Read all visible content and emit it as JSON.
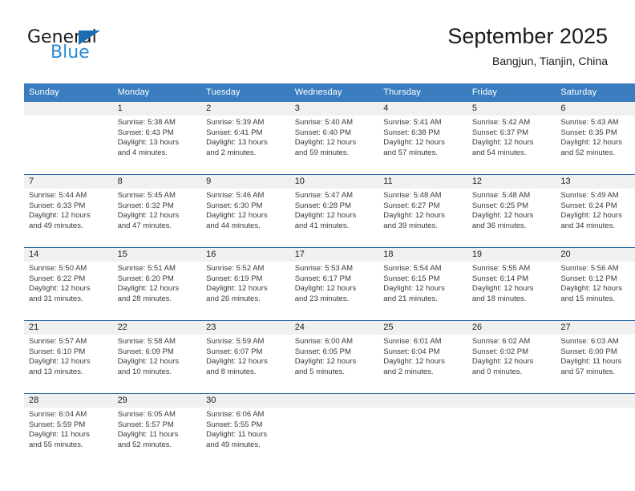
{
  "brand": {
    "name_top": "General",
    "name_bottom": "Blue",
    "accent_color": "#2b8bd4",
    "triangle_color": "#1b6cb3"
  },
  "header": {
    "month_title": "September 2025",
    "location": "Bangjun, Tianjin, China"
  },
  "theme": {
    "header_row_bg": "#3b7ebf",
    "header_row_text": "#ffffff",
    "row_divider": "#2f6fab",
    "daynum_band_bg": "#f0f0f0"
  },
  "calendar": {
    "weekday_headers": [
      "Sunday",
      "Monday",
      "Tuesday",
      "Wednesday",
      "Thursday",
      "Friday",
      "Saturday"
    ],
    "weeks": [
      [
        {
          "day": "",
          "empty": true,
          "sunrise": "",
          "sunset": "",
          "daylight_line1": "",
          "daylight_line2": ""
        },
        {
          "day": "1",
          "empty": false,
          "sunrise": "Sunrise: 5:38 AM",
          "sunset": "Sunset: 6:43 PM",
          "daylight_line1": "Daylight: 13 hours",
          "daylight_line2": "and 4 minutes."
        },
        {
          "day": "2",
          "empty": false,
          "sunrise": "Sunrise: 5:39 AM",
          "sunset": "Sunset: 6:41 PM",
          "daylight_line1": "Daylight: 13 hours",
          "daylight_line2": "and 2 minutes."
        },
        {
          "day": "3",
          "empty": false,
          "sunrise": "Sunrise: 5:40 AM",
          "sunset": "Sunset: 6:40 PM",
          "daylight_line1": "Daylight: 12 hours",
          "daylight_line2": "and 59 minutes."
        },
        {
          "day": "4",
          "empty": false,
          "sunrise": "Sunrise: 5:41 AM",
          "sunset": "Sunset: 6:38 PM",
          "daylight_line1": "Daylight: 12 hours",
          "daylight_line2": "and 57 minutes."
        },
        {
          "day": "5",
          "empty": false,
          "sunrise": "Sunrise: 5:42 AM",
          "sunset": "Sunset: 6:37 PM",
          "daylight_line1": "Daylight: 12 hours",
          "daylight_line2": "and 54 minutes."
        },
        {
          "day": "6",
          "empty": false,
          "sunrise": "Sunrise: 5:43 AM",
          "sunset": "Sunset: 6:35 PM",
          "daylight_line1": "Daylight: 12 hours",
          "daylight_line2": "and 52 minutes."
        }
      ],
      [
        {
          "day": "7",
          "empty": false,
          "sunrise": "Sunrise: 5:44 AM",
          "sunset": "Sunset: 6:33 PM",
          "daylight_line1": "Daylight: 12 hours",
          "daylight_line2": "and 49 minutes."
        },
        {
          "day": "8",
          "empty": false,
          "sunrise": "Sunrise: 5:45 AM",
          "sunset": "Sunset: 6:32 PM",
          "daylight_line1": "Daylight: 12 hours",
          "daylight_line2": "and 47 minutes."
        },
        {
          "day": "9",
          "empty": false,
          "sunrise": "Sunrise: 5:46 AM",
          "sunset": "Sunset: 6:30 PM",
          "daylight_line1": "Daylight: 12 hours",
          "daylight_line2": "and 44 minutes."
        },
        {
          "day": "10",
          "empty": false,
          "sunrise": "Sunrise: 5:47 AM",
          "sunset": "Sunset: 6:28 PM",
          "daylight_line1": "Daylight: 12 hours",
          "daylight_line2": "and 41 minutes."
        },
        {
          "day": "11",
          "empty": false,
          "sunrise": "Sunrise: 5:48 AM",
          "sunset": "Sunset: 6:27 PM",
          "daylight_line1": "Daylight: 12 hours",
          "daylight_line2": "and 39 minutes."
        },
        {
          "day": "12",
          "empty": false,
          "sunrise": "Sunrise: 5:48 AM",
          "sunset": "Sunset: 6:25 PM",
          "daylight_line1": "Daylight: 12 hours",
          "daylight_line2": "and 36 minutes."
        },
        {
          "day": "13",
          "empty": false,
          "sunrise": "Sunrise: 5:49 AM",
          "sunset": "Sunset: 6:24 PM",
          "daylight_line1": "Daylight: 12 hours",
          "daylight_line2": "and 34 minutes."
        }
      ],
      [
        {
          "day": "14",
          "empty": false,
          "sunrise": "Sunrise: 5:50 AM",
          "sunset": "Sunset: 6:22 PM",
          "daylight_line1": "Daylight: 12 hours",
          "daylight_line2": "and 31 minutes."
        },
        {
          "day": "15",
          "empty": false,
          "sunrise": "Sunrise: 5:51 AM",
          "sunset": "Sunset: 6:20 PM",
          "daylight_line1": "Daylight: 12 hours",
          "daylight_line2": "and 28 minutes."
        },
        {
          "day": "16",
          "empty": false,
          "sunrise": "Sunrise: 5:52 AM",
          "sunset": "Sunset: 6:19 PM",
          "daylight_line1": "Daylight: 12 hours",
          "daylight_line2": "and 26 minutes."
        },
        {
          "day": "17",
          "empty": false,
          "sunrise": "Sunrise: 5:53 AM",
          "sunset": "Sunset: 6:17 PM",
          "daylight_line1": "Daylight: 12 hours",
          "daylight_line2": "and 23 minutes."
        },
        {
          "day": "18",
          "empty": false,
          "sunrise": "Sunrise: 5:54 AM",
          "sunset": "Sunset: 6:15 PM",
          "daylight_line1": "Daylight: 12 hours",
          "daylight_line2": "and 21 minutes."
        },
        {
          "day": "19",
          "empty": false,
          "sunrise": "Sunrise: 5:55 AM",
          "sunset": "Sunset: 6:14 PM",
          "daylight_line1": "Daylight: 12 hours",
          "daylight_line2": "and 18 minutes."
        },
        {
          "day": "20",
          "empty": false,
          "sunrise": "Sunrise: 5:56 AM",
          "sunset": "Sunset: 6:12 PM",
          "daylight_line1": "Daylight: 12 hours",
          "daylight_line2": "and 15 minutes."
        }
      ],
      [
        {
          "day": "21",
          "empty": false,
          "sunrise": "Sunrise: 5:57 AM",
          "sunset": "Sunset: 6:10 PM",
          "daylight_line1": "Daylight: 12 hours",
          "daylight_line2": "and 13 minutes."
        },
        {
          "day": "22",
          "empty": false,
          "sunrise": "Sunrise: 5:58 AM",
          "sunset": "Sunset: 6:09 PM",
          "daylight_line1": "Daylight: 12 hours",
          "daylight_line2": "and 10 minutes."
        },
        {
          "day": "23",
          "empty": false,
          "sunrise": "Sunrise: 5:59 AM",
          "sunset": "Sunset: 6:07 PM",
          "daylight_line1": "Daylight: 12 hours",
          "daylight_line2": "and 8 minutes."
        },
        {
          "day": "24",
          "empty": false,
          "sunrise": "Sunrise: 6:00 AM",
          "sunset": "Sunset: 6:05 PM",
          "daylight_line1": "Daylight: 12 hours",
          "daylight_line2": "and 5 minutes."
        },
        {
          "day": "25",
          "empty": false,
          "sunrise": "Sunrise: 6:01 AM",
          "sunset": "Sunset: 6:04 PM",
          "daylight_line1": "Daylight: 12 hours",
          "daylight_line2": "and 2 minutes."
        },
        {
          "day": "26",
          "empty": false,
          "sunrise": "Sunrise: 6:02 AM",
          "sunset": "Sunset: 6:02 PM",
          "daylight_line1": "Daylight: 12 hours",
          "daylight_line2": "and 0 minutes."
        },
        {
          "day": "27",
          "empty": false,
          "sunrise": "Sunrise: 6:03 AM",
          "sunset": "Sunset: 6:00 PM",
          "daylight_line1": "Daylight: 11 hours",
          "daylight_line2": "and 57 minutes."
        }
      ],
      [
        {
          "day": "28",
          "empty": false,
          "sunrise": "Sunrise: 6:04 AM",
          "sunset": "Sunset: 5:59 PM",
          "daylight_line1": "Daylight: 11 hours",
          "daylight_line2": "and 55 minutes."
        },
        {
          "day": "29",
          "empty": false,
          "sunrise": "Sunrise: 6:05 AM",
          "sunset": "Sunset: 5:57 PM",
          "daylight_line1": "Daylight: 11 hours",
          "daylight_line2": "and 52 minutes."
        },
        {
          "day": "30",
          "empty": false,
          "sunrise": "Sunrise: 6:06 AM",
          "sunset": "Sunset: 5:55 PM",
          "daylight_line1": "Daylight: 11 hours",
          "daylight_line2": "and 49 minutes."
        },
        {
          "day": "",
          "empty": true,
          "sunrise": "",
          "sunset": "",
          "daylight_line1": "",
          "daylight_line2": ""
        },
        {
          "day": "",
          "empty": true,
          "sunrise": "",
          "sunset": "",
          "daylight_line1": "",
          "daylight_line2": ""
        },
        {
          "day": "",
          "empty": true,
          "sunrise": "",
          "sunset": "",
          "daylight_line1": "",
          "daylight_line2": ""
        },
        {
          "day": "",
          "empty": true,
          "sunrise": "",
          "sunset": "",
          "daylight_line1": "",
          "daylight_line2": ""
        }
      ]
    ]
  }
}
